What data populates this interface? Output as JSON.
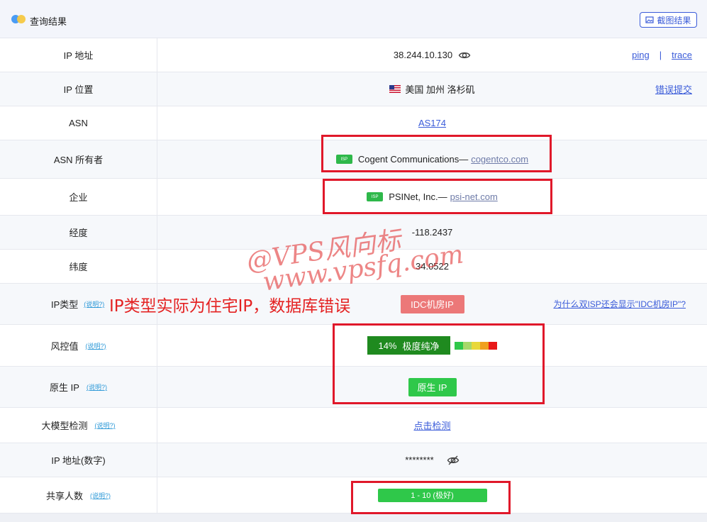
{
  "header": {
    "title": "查询结果",
    "screenshot_label": "截图结果"
  },
  "rows": {
    "ip": {
      "label": "IP 地址",
      "value": "38.244.10.130",
      "ping": "ping",
      "sep": "|",
      "trace": "trace"
    },
    "location": {
      "label": "IP 位置",
      "value": "美国 加州 洛杉矶",
      "report": "错误提交"
    },
    "asn": {
      "label": "ASN",
      "value": "AS174"
    },
    "asn_owner": {
      "label": "ASN 所有者",
      "tag": "ISP",
      "name": "Cogent Communications—",
      "domain": "cogentco.com"
    },
    "company": {
      "label": "企业",
      "tag": "ISP",
      "name": "PSINet, Inc.—",
      "domain": "psi-net.com"
    },
    "longitude": {
      "label": "经度",
      "value": "-118.2437"
    },
    "latitude": {
      "label": "纬度",
      "value": "34.0522"
    },
    "ip_type": {
      "label": "IP类型",
      "explain": "(说明?)",
      "badge": "IDC机房IP",
      "why": "为什么双ISP还会显示\"IDC机房IP\"?"
    },
    "risk": {
      "label": "风控值",
      "explain": "(说明?)",
      "percent": "14%",
      "text": "极度纯净",
      "bar_colors": [
        "#2fc84a",
        "#a7d86a",
        "#e8d83a",
        "#f0a020",
        "#e81818"
      ]
    },
    "native": {
      "label": "原生 IP",
      "explain": "(说明?)",
      "badge": "原生 IP"
    },
    "llm": {
      "label": "大模型检测",
      "explain": "(说明?)",
      "action": "点击检测"
    },
    "ip_numeric": {
      "label": "IP 地址(数字)",
      "value": "********"
    },
    "shared": {
      "label": "共享人数",
      "explain": "(说明?)",
      "value": "1 - 10 (极好)"
    }
  },
  "annotation": "IP类型实际为住宅IP，数据库错误",
  "watermark": {
    "line1": "@VPS风向标",
    "line2": "www.vpsfq.com"
  }
}
